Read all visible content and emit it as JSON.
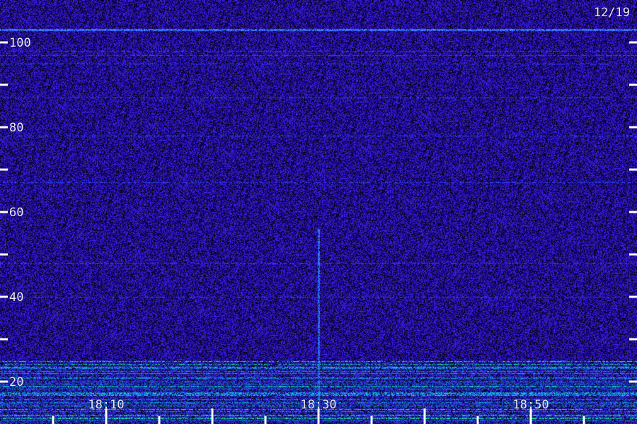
{
  "date_label": "12/19",
  "chart_data": {
    "type": "heatmap",
    "description_kind": "spectrogram",
    "title": "",
    "xlabel": "",
    "ylabel": "",
    "x": {
      "unit": "time",
      "range": [
        "18:00",
        "19:00"
      ],
      "major_ticks": [
        "18:10",
        "18:30",
        "18:50"
      ],
      "minor_tick_interval_min": 5,
      "major_tick_interval_min": 10
    },
    "y": {
      "range": [
        10,
        110
      ],
      "tick_labels": [
        "20",
        "40",
        "60",
        "80",
        "100"
      ],
      "tick_values": [
        20,
        30,
        40,
        50,
        60,
        70,
        80,
        90,
        100
      ]
    },
    "colors": {
      "background": "#1a0a7a",
      "noise_low": "#000010",
      "noise_high": "#3a30ff",
      "strong": "#40ff80",
      "tick": "#ffffff"
    },
    "features": [
      {
        "kind": "horizontal_line",
        "y": 103,
        "strength": "strong"
      },
      {
        "kind": "vertical_streak",
        "time": "18:30",
        "y_range": [
          13,
          56
        ]
      },
      {
        "kind": "low_band_noise",
        "y_range": [
          10,
          25
        ],
        "strength": "strong"
      }
    ]
  }
}
